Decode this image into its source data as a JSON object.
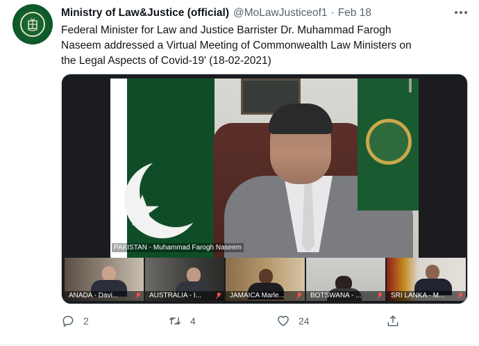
{
  "tweet": {
    "author_name": "Ministry of Law&Justice (official)",
    "handle": "@MoLawJusticeof1",
    "separator": "·",
    "date": "Feb 18",
    "text_lines": [
      "Federal Minister for Law and Justice Barrister Dr. Muhammad Farogh",
      "Naseem addressed a Virtual Meeting of Commonwealth Law Ministers on",
      "the Legal Aspects of Covid-19' (18-02-2021)"
    ]
  },
  "media": {
    "main_label": "PAKISTAN - Muhammad Farogh Naseem",
    "tiles": [
      {
        "label": "ANADA - Davi..."
      },
      {
        "label": "AUSTRALIA - I..."
      },
      {
        "label": "JAMAICA Marle..."
      },
      {
        "label": "BOTSWANA - ..."
      },
      {
        "label": "SRI LANKA - M..."
      }
    ]
  },
  "actions": {
    "reply_count": "2",
    "retweet_count": "4",
    "like_count": "24"
  },
  "icons": {
    "avatar": "ministry-emblem-icon",
    "more": "more-options-icon",
    "reply": "reply-icon",
    "retweet": "retweet-icon",
    "like": "heart-icon",
    "share": "share-icon",
    "mic": "mic-muted-icon"
  },
  "colors": {
    "text": "#0f1419",
    "secondary": "#536471",
    "avatar_green": "#0e5a2a",
    "flag_green": "#0f4d28"
  }
}
